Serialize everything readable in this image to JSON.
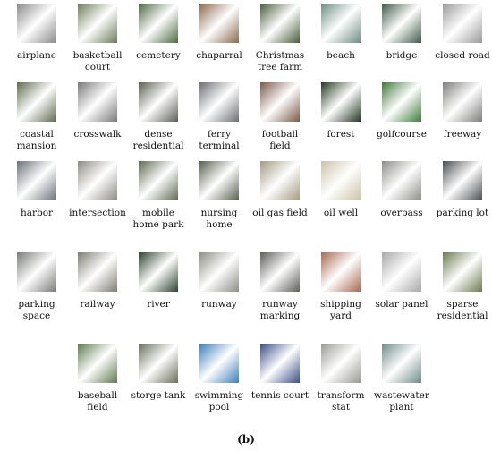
{
  "figure": {
    "caption": "(b)",
    "tiles": [
      {
        "label": "airplane",
        "color": "#8a8a8a"
      },
      {
        "label": "basketball court",
        "color": "#6d7d5a"
      },
      {
        "label": "cemetery",
        "color": "#4f6a45"
      },
      {
        "label": "chaparral",
        "color": "#8d6a4f"
      },
      {
        "label": "Christmas tree farm",
        "color": "#4b5e3c"
      },
      {
        "label": "beach",
        "color": "#6f8d86"
      },
      {
        "label": "bridge",
        "color": "#3f5a4a"
      },
      {
        "label": "closed road",
        "color": "#9a9a9a"
      },
      {
        "label": "coastal mansion",
        "color": "#5f6b4f"
      },
      {
        "label": "crosswalk",
        "color": "#7a7a7a"
      },
      {
        "label": "dense residential",
        "color": "#5b5f55"
      },
      {
        "label": "ferry terminal",
        "color": "#6c6f74"
      },
      {
        "label": "football field",
        "color": "#7a5a4a"
      },
      {
        "label": "forest",
        "color": "#243a24"
      },
      {
        "label": "golfcourse",
        "color": "#3f7a3a"
      },
      {
        "label": "freeway",
        "color": "#7d7d7b"
      },
      {
        "label": "harbor",
        "color": "#6b7177"
      },
      {
        "label": "intersection",
        "color": "#8e8b84"
      },
      {
        "label": "mobile home park",
        "color": "#5f6b52"
      },
      {
        "label": "nursing home",
        "color": "#5a6050"
      },
      {
        "label": "oil gas field",
        "color": "#a59a83"
      },
      {
        "label": "oil well",
        "color": "#cbc2a7"
      },
      {
        "label": "overpass",
        "color": "#8c8c88"
      },
      {
        "label": "parking lot",
        "color": "#4a4c4f"
      },
      {
        "label": "parking space",
        "color": "#7a7c79"
      },
      {
        "label": "railway",
        "color": "#7f7c74"
      },
      {
        "label": "river",
        "color": "#2f4330"
      },
      {
        "label": "runway",
        "color": "#8d8f86"
      },
      {
        "label": "runway marking",
        "color": "#5e5f5a"
      },
      {
        "label": "shipping yard",
        "color": "#a86a52"
      },
      {
        "label": "solar panel",
        "color": "#a8a9aa"
      },
      {
        "label": "sparse residential",
        "color": "#6b7b52"
      },
      {
        "label": "baseball field",
        "color": "#5e7a4f"
      },
      {
        "label": "storge tank",
        "color": "#6a6f5c"
      },
      {
        "label": "swimming pool",
        "color": "#3d7fb8"
      },
      {
        "label": "tennis court",
        "color": "#3a4f86"
      },
      {
        "label": "transform stat",
        "color": "#9a9a94"
      },
      {
        "label": "wastewater plant",
        "color": "#6e8b86"
      }
    ]
  }
}
